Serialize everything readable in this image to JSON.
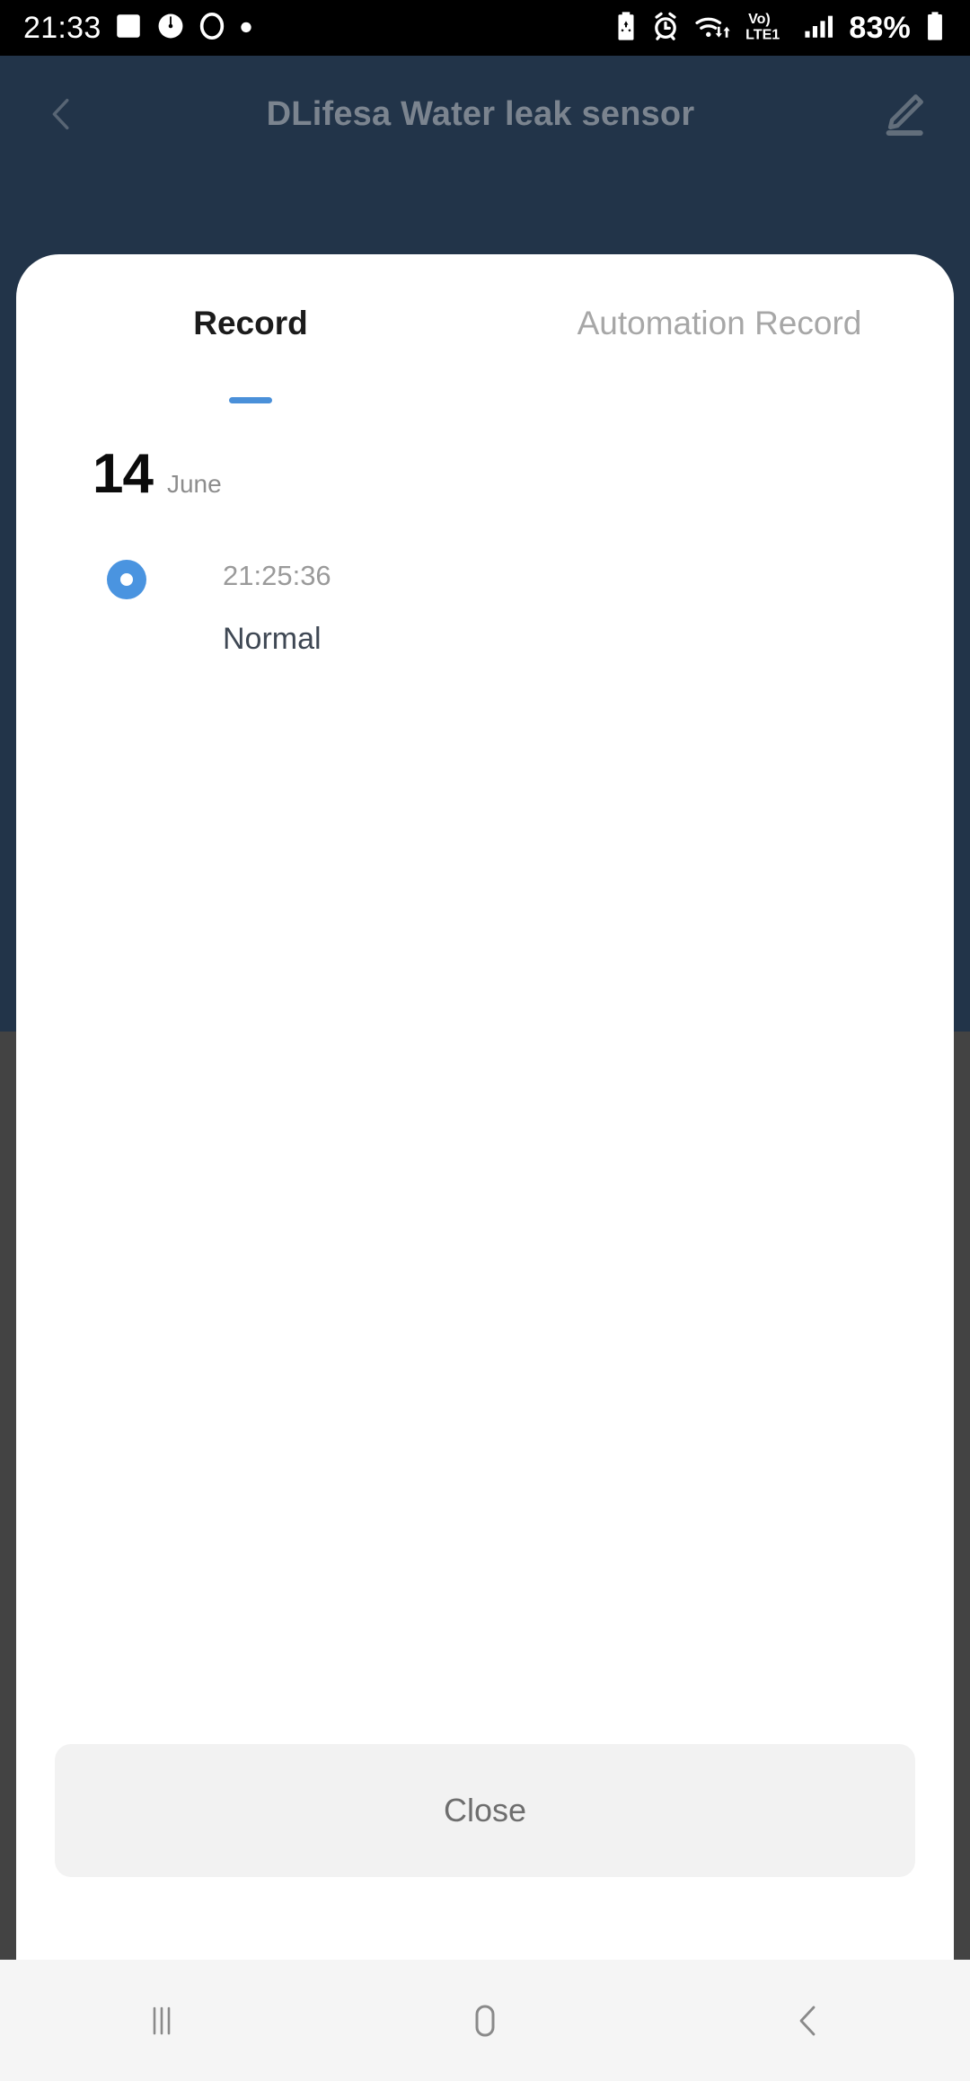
{
  "status_bar": {
    "clock": "21:33",
    "battery_percent": "83%",
    "left_icons": [
      "photo-icon",
      "clock-timer-icon",
      "ring-icon",
      "dot-icon"
    ],
    "right_icons": [
      "battery-saver-icon",
      "alarm-icon",
      "wifi-icon",
      "volte-icon",
      "signal-bars-icon",
      "battery-icon"
    ],
    "volte_top": "Vo)",
    "volte_bottom": "LTE1"
  },
  "app_header": {
    "title": "DLifesa Water leak sensor",
    "back_icon": "chevron-left-icon",
    "edit_icon": "pencil-edit-icon"
  },
  "sheet": {
    "tabs": [
      {
        "label": "Record",
        "active": true
      },
      {
        "label": "Automation Record",
        "active": false
      }
    ],
    "date": {
      "day": "14",
      "month": "June"
    },
    "records": [
      {
        "time": "21:25:36",
        "status": "Normal",
        "marker": "blue-dot-marker"
      }
    ],
    "close_label": "Close"
  },
  "nav_bar": {
    "recents_icon": "recents-icon",
    "home_icon": "home-icon",
    "back_icon": "back-icon"
  },
  "colors": {
    "accent_blue": "#4a90d9",
    "marker_blue": "#4a94e0",
    "backdrop_navy": "#223449",
    "backdrop_gray": "#434343",
    "status_text": "#3f4854"
  }
}
